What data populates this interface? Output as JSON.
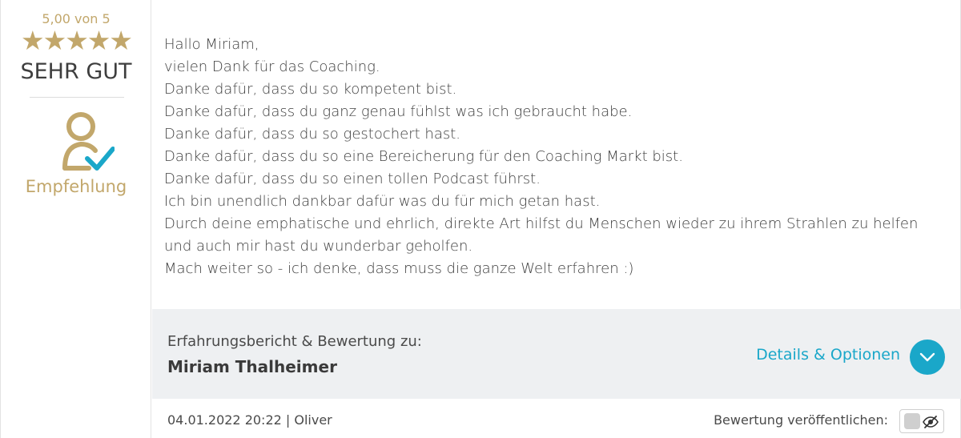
{
  "rating": {
    "score_text": "5,00 von 5",
    "stars_text": "★★★★★",
    "stars_value": 5,
    "stars_max": 5,
    "grade": "SEHR GUT",
    "recommendation_label": "Empfehlung",
    "accent_color": "#c2a76b"
  },
  "review": {
    "lines": [
      "Hallo Miriam,",
      "vielen Dank für das Coaching.",
      "Danke dafür, dass du so kompetent bist.",
      "Danke dafür, dass du ganz genau fühlst was ich gebraucht habe.",
      "Danke dafür, dass du so gestochert hast.",
      "Danke dafür, dass du so eine Bereicherung für den Coaching Markt bist.",
      "Danke dafür, dass du so einen tollen Podcast führst.",
      "Ich bin unendlich dankbar dafür was du für mich getan hast.",
      "Durch deine emphatische und ehrlich, direkte Art hilfst du Menschen wieder zu ihrem Strahlen zu helfen und auch mir hast du wunderbar geholfen.",
      "Mach weiter so - ich denke, dass muss die ganze Welt erfahren :)"
    ]
  },
  "info": {
    "subject_label": "Erfahrungsbericht & Bewertung zu:",
    "subject_name": "Miriam Thalheimer",
    "details_label": "Details & Optionen",
    "details_icon": "chevron-down-icon",
    "link_color": "#1aa7c9"
  },
  "footer": {
    "meta": "04.01.2022 20:22 | Oliver",
    "publish_label": "Bewertung veröffentlichen:",
    "publish_toggle_icon": "eye-off-icon",
    "published": false
  }
}
